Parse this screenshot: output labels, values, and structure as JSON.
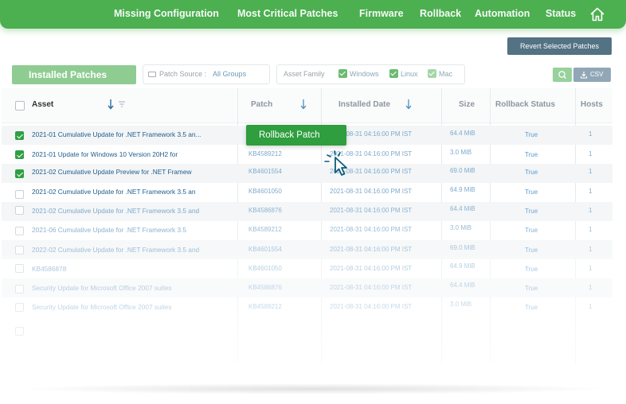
{
  "nav": {
    "items": [
      "Missing Configuration",
      "Most Critical Patches",
      "Firmware",
      "Rollback",
      "Automation",
      "Status"
    ]
  },
  "toolbar": {
    "revert_label": "Revert Selected Patches",
    "installed_label": "Installed Patches",
    "patch_source_label": "Patch Source :",
    "patch_source_value": "All Groups",
    "asset_family_label": "Asset Family",
    "family_options": [
      "Windows",
      "Linux",
      "Mac"
    ],
    "csv_label": "CSV"
  },
  "table": {
    "headers": {
      "asset": "Asset",
      "patch": "Patch",
      "installed_date": "Installed Date",
      "size": "Size",
      "rollback_status": "Rollback Status",
      "hosts": "Hosts"
    },
    "rows": [
      {
        "asset": "2021-01 Cumulative Update for .NET Framework 3.5 an...",
        "patch": "",
        "date": "2021-08-31 04:16:00 PM IST",
        "size": "64.4 MiB",
        "rollback": "True",
        "hosts": "1",
        "checked": true
      },
      {
        "asset": "2021-01 Update for Windows 10 Version 20H2 for",
        "patch": "KB4589212",
        "date": "2021-08-31 04:16:00 PM IST",
        "size": "3.0 MiB",
        "rollback": "True",
        "hosts": "1",
        "checked": true
      },
      {
        "asset": "2021-02 Cumulative Update Preview for .NET Framew",
        "patch": "KB4601554",
        "date": "2021-08-31 04:16:00 PM IST",
        "size": "69.0 MiB",
        "rollback": "True",
        "hosts": "1",
        "checked": true
      },
      {
        "asset": "2021-02 Cumulative Update for .NET Framework 3.5 an",
        "patch": "KB4601050",
        "date": "2021-08-31 04:16:00 PM IST",
        "size": "64.9 MiB",
        "rollback": "True",
        "hosts": "1",
        "checked": false
      },
      {
        "asset": "2021-02 Cumulative Update for .NET Framework 3.5 and",
        "patch": "KB4586876",
        "date": "2021-08-31 04:16:00 PM IST",
        "size": "64.4 MiB",
        "rollback": "True",
        "hosts": "1",
        "checked": false
      },
      {
        "asset": "2021-06 Cumulative Update for .NET Framework 3.5",
        "patch": "KB4589212",
        "date": "2021-08-31 04:16:00 PM IST",
        "size": "3.0 MiB",
        "rollback": "True",
        "hosts": "1",
        "checked": false
      },
      {
        "asset": "2022-02 Cumulative Update for .NET Framework 3.5 and",
        "patch": "KB4601554",
        "date": "2021-08-31 04:16:00 PM IST",
        "size": "69.0 MiB",
        "rollback": "True",
        "hosts": "1",
        "checked": false
      },
      {
        "asset": "KB4586878",
        "patch": "KB4601050",
        "date": "2021-08-31 04:16:00 PM IST",
        "size": "64.9 MiB",
        "rollback": "True",
        "hosts": "1",
        "checked": false
      },
      {
        "asset": "Security Update for Microsoft Office 2007 suites",
        "patch": "KB4586876",
        "date": "2021-08-31 04:16:00 PM IST",
        "size": "64.4 MiB",
        "rollback": "True",
        "hosts": "1",
        "checked": false
      },
      {
        "asset": "Security Update for Microsoft Office 2007 suites",
        "patch": "KB4589212",
        "date": "2021-08-31 04:16:00 PM IST",
        "size": "3.0 MiB",
        "rollback": "True",
        "hosts": "1",
        "checked": false
      }
    ]
  },
  "popup": {
    "rollback_label": "Rollback Patch"
  },
  "colors": {
    "nav_green": "#4caf50",
    "primary_green": "#2e9e3e",
    "revert_slate": "#537283",
    "link_blue": "#1f5c8c"
  }
}
